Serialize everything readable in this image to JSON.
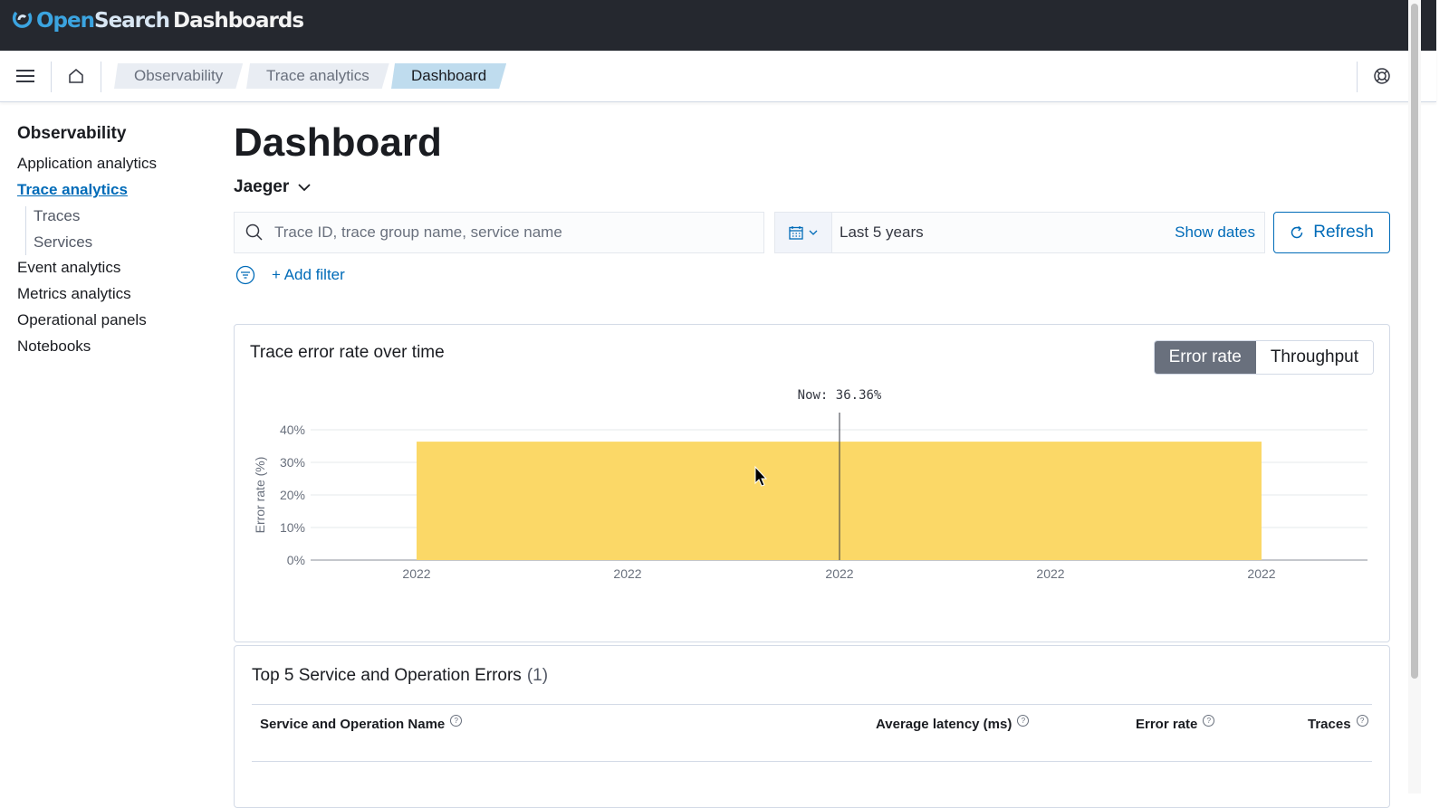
{
  "app": {
    "logo_open": "Open",
    "logo_search": "Search",
    "logo_dashboards": "Dashboards"
  },
  "breadcrumbs": [
    "Observability",
    "Trace analytics",
    "Dashboard"
  ],
  "sidebar": {
    "title": "Observability",
    "items": [
      {
        "label": "Application analytics"
      },
      {
        "label": "Trace analytics",
        "active": true
      },
      {
        "label": "Traces",
        "sub": true
      },
      {
        "label": "Services",
        "sub": true
      },
      {
        "label": "Event analytics"
      },
      {
        "label": "Metrics analytics"
      },
      {
        "label": "Operational panels"
      },
      {
        "label": "Notebooks"
      }
    ]
  },
  "main": {
    "title": "Dashboard",
    "source": "Jaeger",
    "search_placeholder": "Trace ID, trace group name, service name",
    "date_range": "Last 5 years",
    "show_dates": "Show dates",
    "refresh": "Refresh",
    "add_filter": "+ Add filter"
  },
  "panel": {
    "title": "Trace error rate over time",
    "toggle": [
      "Error rate",
      "Throughput"
    ],
    "toggle_selected": "Error rate"
  },
  "chart_data": {
    "type": "bar",
    "title": "",
    "ylabel": "Error rate (%)",
    "xlabel": "",
    "x_tick_labels": [
      "2022",
      "2022",
      "2022",
      "2022",
      "2022"
    ],
    "y_tick_labels": [
      "0%",
      "10%",
      "20%",
      "30%",
      "40%"
    ],
    "ylim": [
      0,
      40
    ],
    "values": [
      36.36
    ],
    "annotation": "Now: 36.36%",
    "bar_color": "#fbd867",
    "grid": true
  },
  "errors_table": {
    "title": "Top 5 Service and Operation Errors",
    "count": "(1)",
    "columns": [
      "Service and Operation Name",
      "Average latency (ms)",
      "Error rate",
      "Traces"
    ]
  },
  "colors": {
    "accent": "#006bb8",
    "header_bg": "#25282f",
    "toggle_on": "#69707d"
  }
}
